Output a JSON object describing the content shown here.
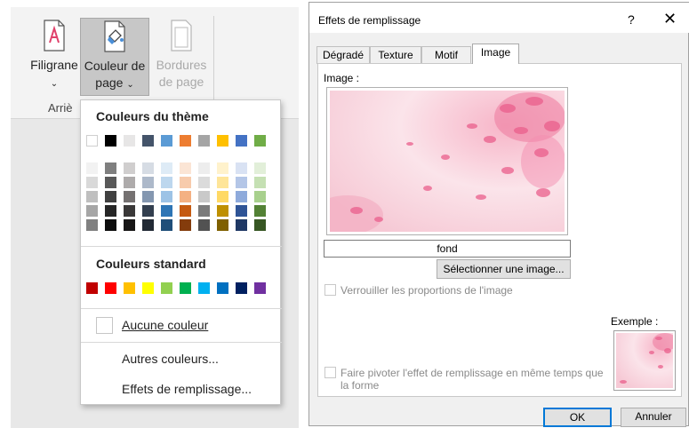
{
  "ribbon": {
    "filigrane_label": "Filigrane",
    "couleur_line1": "Couleur de",
    "couleur_line2": "page",
    "bordures_line1": "Bordures",
    "bordures_line2": "de page",
    "group_label": "Arriè"
  },
  "dropdown": {
    "theme_heading": "Couleurs du thème",
    "theme_top": [
      "#ffffff",
      "#000000",
      "#e7e6e6",
      "#44546a",
      "#5b9bd5",
      "#ed7d31",
      "#a5a5a5",
      "#ffc000",
      "#4472c4",
      "#70ad47"
    ],
    "theme_shades": [
      [
        "#f2f2f2",
        "#d9d9d9",
        "#bfbfbf",
        "#a6a6a6",
        "#808080"
      ],
      [
        "#7f7f7f",
        "#595959",
        "#404040",
        "#262626",
        "#0d0d0d"
      ],
      [
        "#d0cece",
        "#aeabab",
        "#757171",
        "#3a3838",
        "#171616"
      ],
      [
        "#d6dce4",
        "#adb9ca",
        "#8497b0",
        "#333f4f",
        "#222a35"
      ],
      [
        "#deebf6",
        "#bdd7ee",
        "#9dc3e6",
        "#2e75b5",
        "#1f4e79"
      ],
      [
        "#fbe5d5",
        "#f7cbac",
        "#f4b183",
        "#c55a11",
        "#843c0c"
      ],
      [
        "#ededed",
        "#dbdbdb",
        "#c9c9c9",
        "#7b7b7b",
        "#525252"
      ],
      [
        "#fff2cc",
        "#fee599",
        "#ffd965",
        "#bf9000",
        "#7f6000"
      ],
      [
        "#d9e2f3",
        "#b4c6e7",
        "#8eaadb",
        "#2f5496",
        "#1f3864"
      ],
      [
        "#e2efd9",
        "#c5e0b3",
        "#a8d08d",
        "#538135",
        "#375623"
      ]
    ],
    "standard_heading": "Couleurs standard",
    "standard_colors": [
      "#c00000",
      "#ff0000",
      "#ffc000",
      "#ffff00",
      "#92d050",
      "#00b050",
      "#00b0f0",
      "#0070c0",
      "#002060",
      "#7030a0"
    ],
    "no_color": "Aucune couleur",
    "more_colors": "Autres couleurs...",
    "fill_effects": "Effets de remplissage..."
  },
  "dialog": {
    "title": "Effets de remplissage",
    "help": "?",
    "close": "✕",
    "tabs": [
      "Dégradé",
      "Texture",
      "Motif",
      "Image"
    ],
    "image_label": "Image :",
    "image_name": "fond",
    "select_button": "Sélectionner une image...",
    "lock_ratio": "Verrouiller les proportions de l'image",
    "rotate_line1": "Faire pivoter l'effet de remplissage en même temps que",
    "rotate_line2": "la forme",
    "example_label": "Exemple :",
    "ok": "OK",
    "cancel": "Annuler"
  }
}
